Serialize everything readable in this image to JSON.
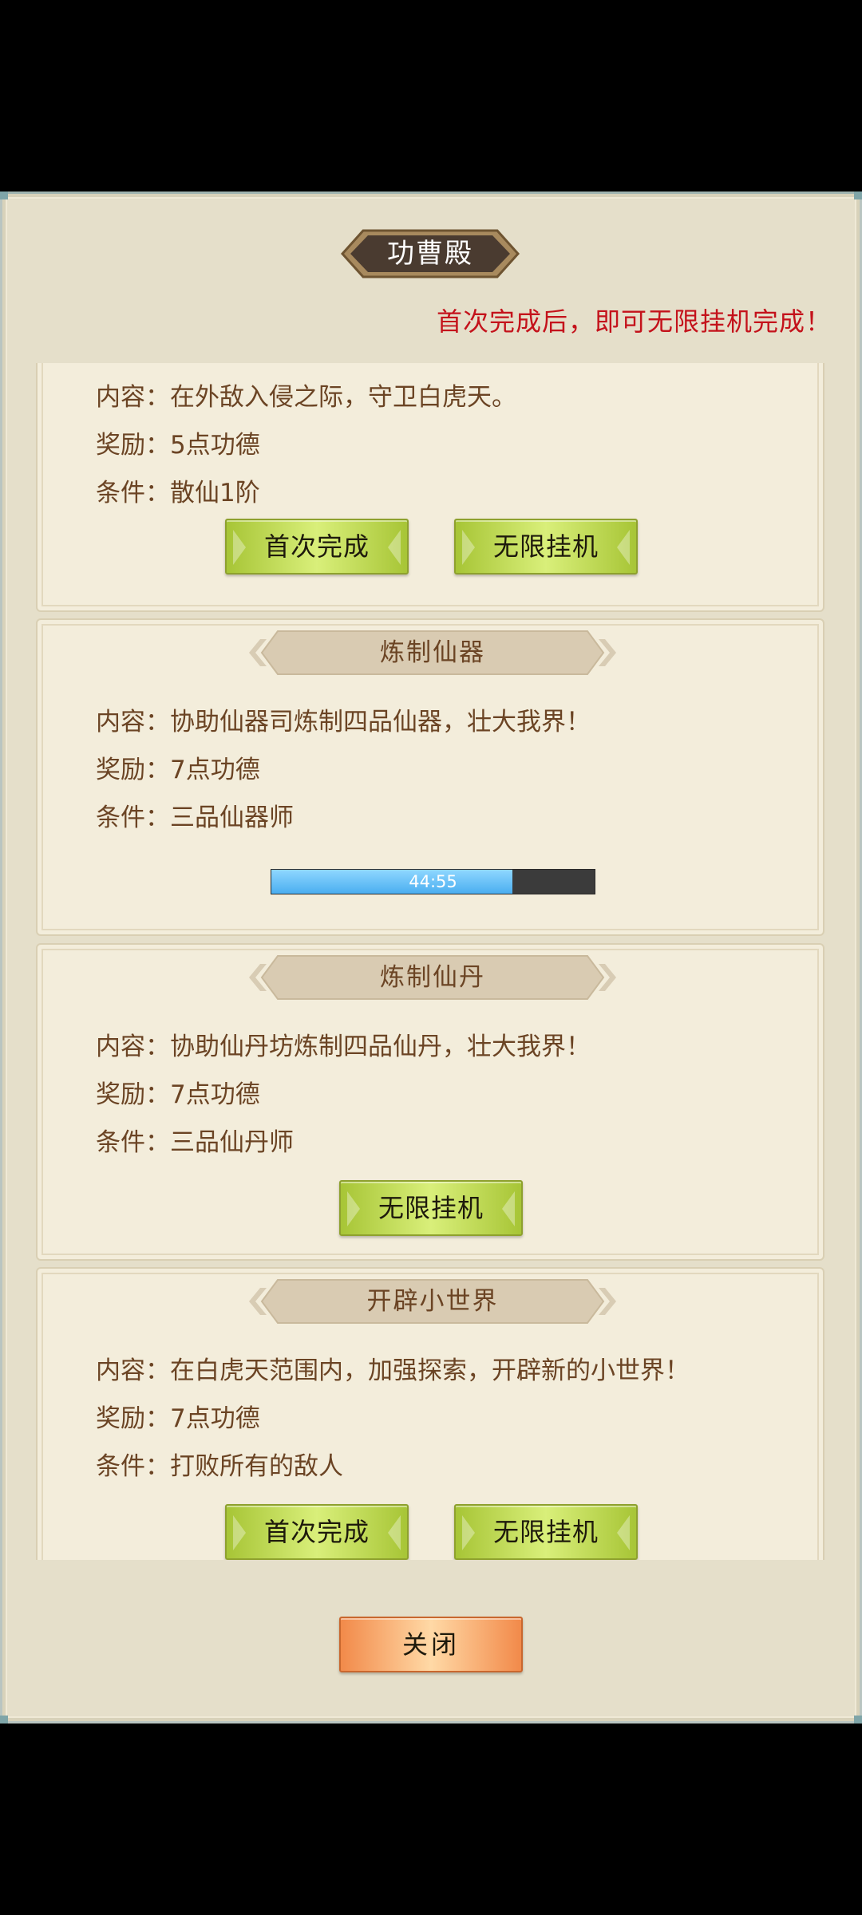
{
  "window": {
    "title": "功曹殿",
    "notice": "首次完成后，即可无限挂机完成！",
    "close_label": "关闭"
  },
  "tasks": [
    {
      "title": "",
      "content": "内容：在外敌入侵之际，守卫白虎天。",
      "reward": "奖励：5点功德",
      "condition": "条件：散仙1阶",
      "buttons": [
        "首次完成",
        "无限挂机"
      ]
    },
    {
      "title": "炼制仙器",
      "content": "内容：协助仙器司炼制四品仙器，壮大我界！",
      "reward": "奖励：7点功德",
      "condition": "条件：三品仙器师",
      "progress": {
        "label": "44:55",
        "fraction": 0.745
      }
    },
    {
      "title": "炼制仙丹",
      "content": "内容：协助仙丹坊炼制四品仙丹，壮大我界！",
      "reward": "奖励：7点功德",
      "condition": "条件：三品仙丹师",
      "buttons": [
        "无限挂机"
      ]
    },
    {
      "title": "开辟小世界",
      "content": "内容：在白虎天范围内，加强探索，开辟新的小世界！",
      "reward": "奖励：7点功德",
      "condition": "条件：打败所有的敌人",
      "buttons": [
        "首次完成",
        "无限挂机"
      ]
    }
  ],
  "colors": {
    "accent_red": "#c4121b",
    "text_brown": "#6b4424",
    "button_green": "#c6e05a",
    "button_orange": "#f7a66a",
    "progress_blue": "#6cc4f8"
  }
}
